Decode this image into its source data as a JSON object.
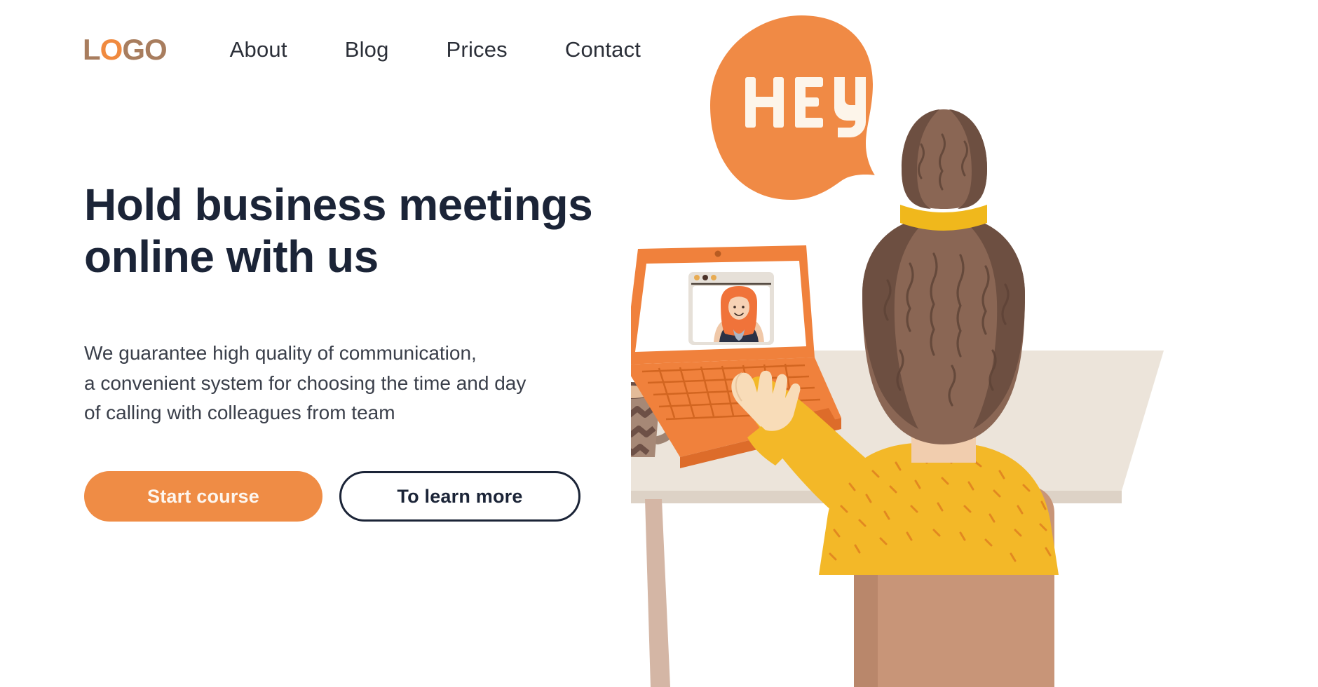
{
  "brand": {
    "logo_text": "LOGO",
    "logo_letters": [
      "L",
      "O",
      "G",
      "O"
    ],
    "logo_colors": [
      "#a87d5e",
      "#f08a3f",
      "#a87d5e",
      "#a87d5e"
    ]
  },
  "nav": {
    "items": [
      {
        "label": "About"
      },
      {
        "label": "Blog"
      },
      {
        "label": "Prices"
      },
      {
        "label": "Contact"
      }
    ]
  },
  "hero": {
    "headline_line1": "Hold business meetings",
    "headline_line2": "online with us",
    "subtext_line1": "We guarantee high quality of communication,",
    "subtext_line2": "a convenient system for choosing the time and day",
    "subtext_line3": "of calling with colleagues from team",
    "primary_button": "Start course",
    "secondary_button": "To learn more"
  },
  "illustration": {
    "speech_bubble_text": "HEY",
    "scene_items": [
      "speech-bubble",
      "woman-back-view",
      "laptop",
      "video-call-window",
      "remote-participant",
      "coffee-mug",
      "desk",
      "chair"
    ]
  },
  "colors": {
    "accent_orange": "#ef8c45",
    "bubble_orange": "#f08a45",
    "dark_navy": "#1b2437",
    "logo_brown": "#a87d5e",
    "sweater_yellow": "#f3b828",
    "hair_brown": "#7d5b4a",
    "desk_beige": "#e9e1d8",
    "chair_tan": "#c89578",
    "laptop_orange": "#f0813c",
    "page_background": "#ffffff"
  }
}
